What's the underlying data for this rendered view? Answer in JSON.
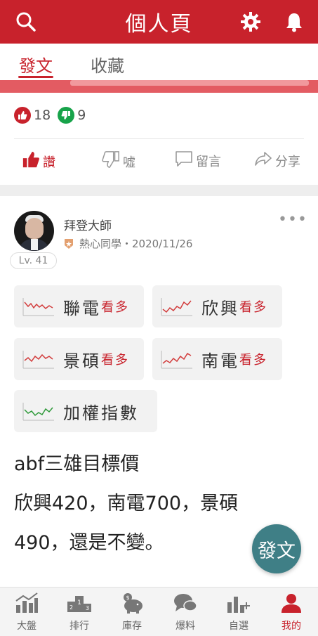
{
  "header": {
    "title": "個人頁"
  },
  "tabs": [
    {
      "label": "發文"
    },
    {
      "label": "收藏"
    }
  ],
  "reactions": {
    "likes": "18",
    "dislikes": "9"
  },
  "actions": {
    "like": "讚",
    "boo": "噓",
    "comment": "留言",
    "share": "分享"
  },
  "post": {
    "author": "拜登大師",
    "rank": "熱心同學",
    "date": "2020/11/26",
    "meta": "熱心同學・2020/11/26",
    "level": "Lv. 41",
    "more": "•••",
    "stocks": [
      {
        "name": "聯電",
        "sentiment": "看多",
        "trend_color": "#d23c3c"
      },
      {
        "name": "欣興",
        "sentiment": "看多",
        "trend_color": "#d23c3c"
      },
      {
        "name": "景碩",
        "sentiment": "看多",
        "trend_color": "#d23c3c"
      },
      {
        "name": "南電",
        "sentiment": "看多",
        "trend_color": "#d23c3c"
      },
      {
        "name": "加權指數",
        "sentiment": "",
        "trend_color": "#2f9a3a"
      }
    ],
    "body_lines": [
      "abf三雄目標價",
      "欣興420，南電700，景碩",
      "490，還是不變。"
    ]
  },
  "fab": {
    "label": "發文"
  },
  "bottom_nav": [
    {
      "label": "大盤",
      "icon": "chart-bar-icon"
    },
    {
      "label": "排行",
      "icon": "podium-icon"
    },
    {
      "label": "庫存",
      "icon": "piggy-bank-icon"
    },
    {
      "label": "爆料",
      "icon": "chat-bubbles-icon"
    },
    {
      "label": "自選",
      "icon": "add-chart-icon"
    },
    {
      "label": "我的",
      "icon": "user-icon"
    }
  ],
  "colors": {
    "brand": "#c8222c",
    "fab": "#3f7f86",
    "like_green": "#17a34a"
  }
}
